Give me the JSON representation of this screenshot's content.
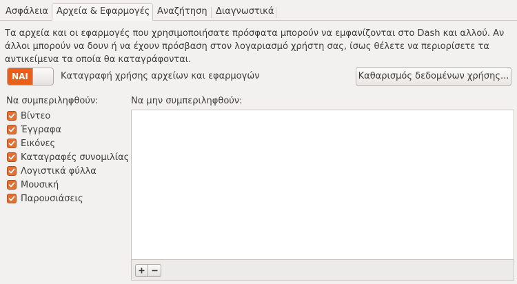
{
  "tabs": [
    {
      "label": "Ασφάλεια",
      "active": false
    },
    {
      "label": "Αρχεία & Εφαρμογές",
      "active": true
    },
    {
      "label": "Αναζήτηση",
      "active": false
    },
    {
      "label": "Διαγνωστικά",
      "active": false
    }
  ],
  "description": "Τα αρχεία και οι εφαρμογές που χρησιμοποιήσατε πρόσφατα μπορούν να εμφανίζονται στο Dash και αλλού. Αν\nάλλοι μπορούν να δουν ή να έχουν πρόσβαση στον λογαριασμό χρήστη σας, ίσως θέλετε να περιορίσετε τα\nαντικείμενα τα οποία θα καταγράφονται.",
  "recording": {
    "toggle_label": "ΝΑΙ",
    "toggle_state": "on",
    "label": "Καταγραφή χρήσης αρχείων και εφαρμογών",
    "clear_button": "Καθαρισμός δεδομένων χρήσης..."
  },
  "include": {
    "heading": "Να συμπεριληφθούν:",
    "items": [
      {
        "label": "Βίντεο",
        "checked": true
      },
      {
        "label": "Έγγραφα",
        "checked": true
      },
      {
        "label": "Εικόνες",
        "checked": true
      },
      {
        "label": "Καταγραφές συνομιλίας",
        "checked": true
      },
      {
        "label": "Λογιστικά φύλλα",
        "checked": true
      },
      {
        "label": "Μουσική",
        "checked": true
      },
      {
        "label": "Παρουσιάσεις",
        "checked": true
      }
    ]
  },
  "exclude": {
    "heading": "Να μην συμπεριληφθούν:",
    "items": [],
    "add_icon": "plus-icon",
    "remove_icon": "minus-icon"
  },
  "colors": {
    "accent": "#e95e1a",
    "checkbox": "#e36f30"
  }
}
